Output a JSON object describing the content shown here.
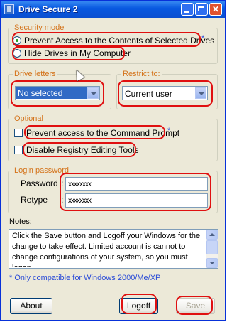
{
  "window": {
    "title": "Drive Secure 2"
  },
  "security_mode": {
    "legend": "Security mode",
    "option1": "Prevent Access to the Contents of Selected Drives",
    "option1_star": "*",
    "option2": "Hide Drives in My Computer",
    "selected": "option1"
  },
  "drive_letters": {
    "legend": "Drive letters",
    "value": "No selected"
  },
  "restrict_to": {
    "legend": "Restrict to:",
    "value": "Current user"
  },
  "optional": {
    "legend": "Optional",
    "cmd_label": "Prevent access to the Command Prompt",
    "cmd_star": "*",
    "cmd_checked": false,
    "registry_label": "Disable Registry Editing Tools",
    "registry_checked": false
  },
  "login_password": {
    "legend": "Login password",
    "password_label": "Password",
    "password_value": "xxxxxxxx",
    "retype_label": "Retype",
    "retype_value": "xxxxxxxx"
  },
  "notes": {
    "label": "Notes:",
    "text": "Click the Save button and Logoff your Windows for the change to take effect. Limited account is cannot to change configurations of your system, so you must logon"
  },
  "footnote": "* Only compatible for Windows 2000/Me/XP",
  "buttons": {
    "about": "About",
    "logoff": "Logoff",
    "save": "Save"
  },
  "colors": {
    "legend": "#d4731a",
    "annotation": "#e01010",
    "titlebar": "#0858e0"
  }
}
